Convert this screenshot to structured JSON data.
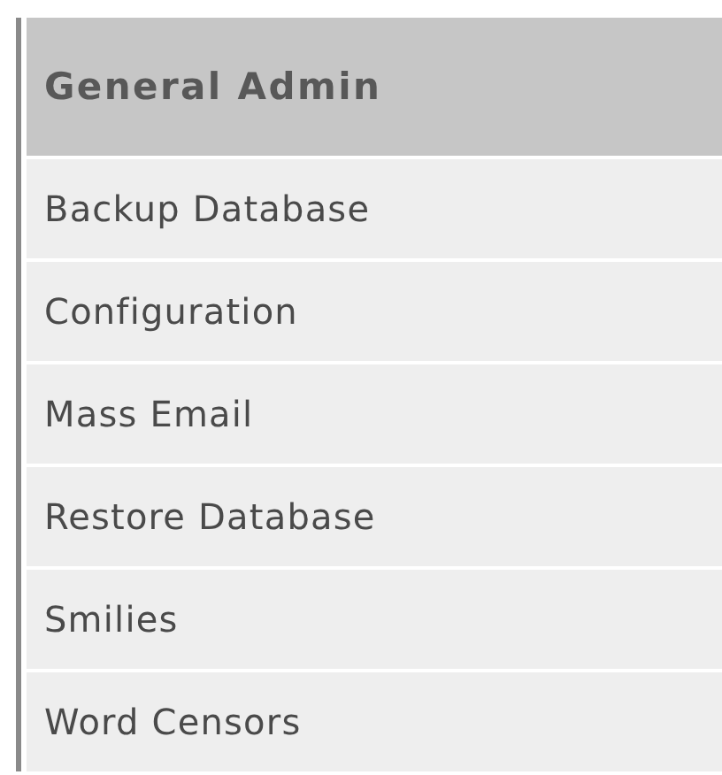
{
  "menu": {
    "title": "General Admin",
    "items": [
      {
        "label": "Backup Database"
      },
      {
        "label": "Configuration"
      },
      {
        "label": "Mass Email"
      },
      {
        "label": "Restore Database"
      },
      {
        "label": "Smilies"
      },
      {
        "label": "Word Censors"
      }
    ]
  }
}
